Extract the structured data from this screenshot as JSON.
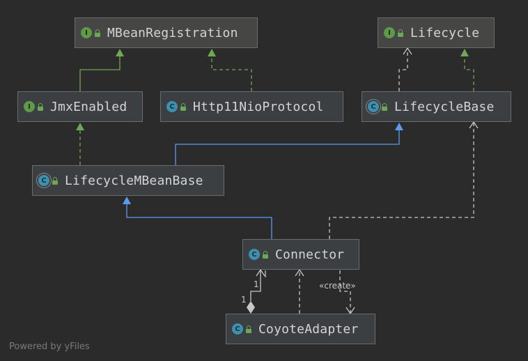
{
  "nodes": {
    "mbean_registration": {
      "name": "MBeanRegistration",
      "kind_letter": "I"
    },
    "lifecycle": {
      "name": "Lifecycle",
      "kind_letter": "I"
    },
    "jmx_enabled": {
      "name": "JmxEnabled",
      "kind_letter": "I"
    },
    "http11_nio_protocol": {
      "name": "Http11NioProtocol",
      "kind_letter": "C"
    },
    "lifecycle_base": {
      "name": "LifecycleBase",
      "kind_letter": "C"
    },
    "lifecycle_mbean_base": {
      "name": "LifecycleMBeanBase",
      "kind_letter": "C"
    },
    "connector": {
      "name": "Connector",
      "kind_letter": "C"
    },
    "coyote_adapter": {
      "name": "CoyoteAdapter",
      "kind_letter": "C"
    }
  },
  "edge_labels": {
    "create": "«create»",
    "multiplicity_upper": "1",
    "multiplicity_lower": "1"
  },
  "watermark": "Powered by yFiles",
  "colors": {
    "background": "#2b2b2b",
    "extends_edge": "#5b9bf0",
    "interface_edge": "#6fa855",
    "dependency_edge": "#c8c8c8"
  }
}
